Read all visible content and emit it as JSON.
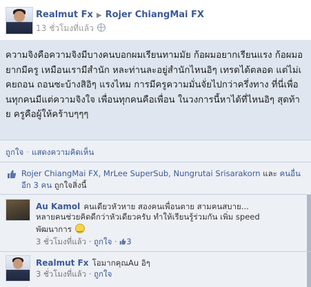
{
  "post": {
    "author": "Realmut Fx",
    "target": "Rojer ChiangMai FX",
    "time": "13 ชั่วโมงที่แล้ว",
    "text": "ความจิงคือความจิงมีบางคนบอกผมเรียนทามมัย ก้อผมอยากเรียนแรง ก้อผมอยากมีครู เหมือนเรามีสำนัก หละท่านละอยู่สำนักไหนอิๆ เทรดได้ตลอด แต่ไม่เคยถอน ถอนซะบ้างสิอิๆ แรงไหม การมีครูความมั่นจั่ยไปกว่าครึ่งทาง ที่นี่เพื่อนทุกคนมีแต่ความจิงใจ เพื่อนทุกคนคือเพื่อน ในวงการนี้หาได้ที่ไหนอิๆ สุดท้าย ครูคือผู้ให้คร้าบๆๆๆ"
  },
  "actions": {
    "like": "ถูกใจ",
    "separator": "·",
    "comment": "แสดงความคิดเห็น"
  },
  "likes": {
    "names": "Rojer ChiangMai FX, MrLee SuperSub, Nungrutai Srisarakorn",
    "and": " และ",
    "others": "คนอื่นอีก 3 คน",
    "suffix": " ถูกใจสิ่งนี้"
  },
  "comments": [
    {
      "author": "Au Kamol",
      "text_line1": "คนเดียวหัวหาย สองคนเพื่อนตาย สามคนสบาย...",
      "text_line2": "หลายคนช่วยคิดดีกว่าหัวเดียวครับ ทำให้เรียนรู้ร่วมกัน เพิ่ม speed",
      "text_line3": "พัฒนาการ",
      "time": "3 ชั่วโมงที่แล้ว",
      "like": "ถูกใจ",
      "like_count": "3"
    },
    {
      "author": "Realmut Fx",
      "text_line1": "โอมากคุณAu อิๆ",
      "time": "3 ชั่วโมงที่แล้ว",
      "like": "ถูกใจ"
    }
  ],
  "icons": {
    "audience": "globe-icon",
    "likes": "thumbs-up-icon",
    "comment_like": "thumbs-up-icon",
    "emoticon": "smile-emoticon-icon"
  },
  "colors": {
    "link": "#3b5998",
    "post_bg": "#dfe6ef",
    "feedback_bg": "#edf0f5"
  }
}
